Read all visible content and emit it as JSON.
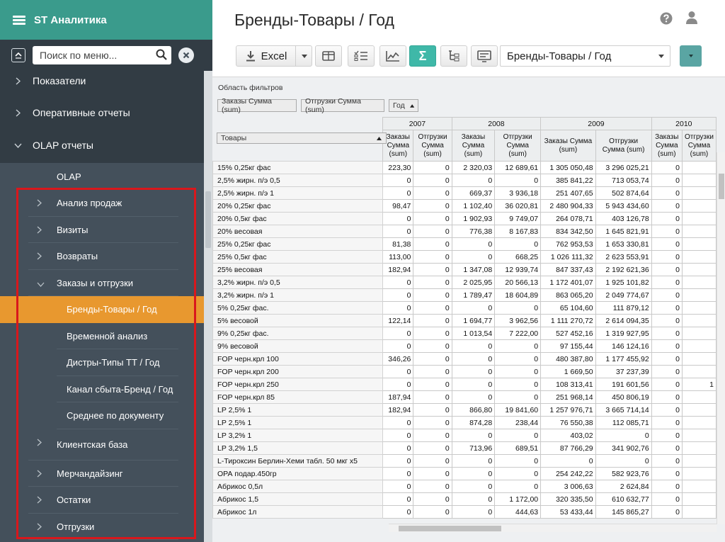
{
  "app": {
    "name": "ST Аналитика"
  },
  "search": {
    "placeholder": "Поиск по меню..."
  },
  "menu": {
    "top": [
      {
        "label": "Показатели",
        "expanded": false
      },
      {
        "label": "Оперативные отчеты",
        "expanded": false
      },
      {
        "label": "OLAP отчеты",
        "expanded": true
      }
    ],
    "olap_root": "OLAP",
    "groups_before": [
      {
        "label": "Анализ продаж"
      },
      {
        "label": "Визиты"
      },
      {
        "label": "Возвраты"
      },
      {
        "label": "Заказы и отгрузки",
        "expanded": true
      }
    ],
    "children": [
      {
        "label": "Бренды-Товары / Год",
        "active": true
      },
      {
        "label": "Временной анализ"
      },
      {
        "label": "Дистры-Типы ТТ / Год"
      },
      {
        "label": "Канал сбыта-Бренд / Год"
      },
      {
        "label": "Среднее по документу"
      }
    ],
    "groups_after": [
      {
        "label": "Клиентская база"
      },
      {
        "label": "Мерчандайзинг"
      },
      {
        "label": "Остатки"
      },
      {
        "label": "Отгрузки"
      }
    ]
  },
  "page": {
    "title": "Бренды-Товары / Год"
  },
  "toolbar": {
    "excel_label": "Excel",
    "sigma_label": "Σ",
    "report_select_value": "Бренды-Товары / Год",
    "accent": "#3fb8a8"
  },
  "pivot": {
    "filter_area_label": "Область фильтров",
    "chips": [
      "Заказы Сумма (sum)",
      "Отгрузки Сумма (sum)",
      "Год"
    ],
    "rows_field": "Товары",
    "years": [
      "2007",
      "2008",
      "2009",
      "2010"
    ],
    "measures": [
      "Заказы Сумма (sum)",
      "Отгрузки Сумма (sum)",
      "Заказы Сумма (sum)",
      "Отгрузки Сумма (sum)",
      "Заказы Сумма (sum)",
      "Отгрузки Сумма (sum)",
      "Заказы Сумма (sum)",
      "Отгрузки Сумма (sum)"
    ],
    "rows": [
      {
        "name": "15% 0,25кг фас",
        "v": [
          "223,30",
          "0",
          "2 320,03",
          "12 689,61",
          "1 305 050,48",
          "3 296 025,21",
          "0",
          ""
        ]
      },
      {
        "name": "2,5% жирн. п/э 0,5",
        "v": [
          "0",
          "0",
          "0",
          "0",
          "385 841,22",
          "713 053,74",
          "0",
          ""
        ]
      },
      {
        "name": "2,5% жирн. п/э 1",
        "v": [
          "0",
          "0",
          "669,37",
          "3 936,18",
          "251 407,65",
          "502 874,64",
          "0",
          ""
        ]
      },
      {
        "name": "20% 0,25кг фас",
        "v": [
          "98,47",
          "0",
          "1 102,40",
          "36 020,81",
          "2 480 904,33",
          "5 943 434,60",
          "0",
          ""
        ]
      },
      {
        "name": "20% 0,5кг фас",
        "v": [
          "0",
          "0",
          "1 902,93",
          "9 749,07",
          "264 078,71",
          "403 126,78",
          "0",
          ""
        ]
      },
      {
        "name": "20% весовая",
        "v": [
          "0",
          "0",
          "776,38",
          "8 167,83",
          "834 342,50",
          "1 645 821,91",
          "0",
          ""
        ]
      },
      {
        "name": "25% 0,25кг фас",
        "v": [
          "81,38",
          "0",
          "0",
          "0",
          "762 953,53",
          "1 653 330,81",
          "0",
          ""
        ]
      },
      {
        "name": "25% 0,5кг фас",
        "v": [
          "113,00",
          "0",
          "0",
          "668,25",
          "1 026 111,32",
          "2 623 553,91",
          "0",
          ""
        ]
      },
      {
        "name": "25% весовая",
        "v": [
          "182,94",
          "0",
          "1 347,08",
          "12 939,74",
          "847 337,43",
          "2 192 621,36",
          "0",
          ""
        ]
      },
      {
        "name": "3,2% жирн. п/э 0,5",
        "v": [
          "0",
          "0",
          "2 025,95",
          "20 566,13",
          "1 172 401,07",
          "1 925 101,82",
          "0",
          ""
        ]
      },
      {
        "name": "3,2% жирн. п/э 1",
        "v": [
          "0",
          "0",
          "1 789,47",
          "18 604,89",
          "863 065,20",
          "2 049 774,67",
          "0",
          ""
        ]
      },
      {
        "name": "5% 0,25кг фас.",
        "v": [
          "0",
          "0",
          "0",
          "0",
          "65 104,60",
          "111 879,12",
          "0",
          ""
        ]
      },
      {
        "name": "5% весовой",
        "v": [
          "122,14",
          "0",
          "1 694,77",
          "3 962,56",
          "1 111 270,72",
          "2 614 094,35",
          "0",
          ""
        ]
      },
      {
        "name": "9% 0,25кг фас.",
        "v": [
          "0",
          "0",
          "1 013,54",
          "7 222,00",
          "527 452,16",
          "1 319 927,95",
          "0",
          ""
        ]
      },
      {
        "name": "9% весовой",
        "v": [
          "0",
          "0",
          "0",
          "0",
          "97 155,44",
          "146 124,16",
          "0",
          ""
        ]
      },
      {
        "name": "FOP черн.крл 100",
        "v": [
          "346,26",
          "0",
          "0",
          "0",
          "480 387,80",
          "1 177 455,92",
          "0",
          ""
        ]
      },
      {
        "name": "FOP черн.крл 200",
        "v": [
          "0",
          "0",
          "0",
          "0",
          "1 669,50",
          "37 237,39",
          "0",
          ""
        ]
      },
      {
        "name": "FOP черн.крл 250",
        "v": [
          "0",
          "0",
          "0",
          "0",
          "108 313,41",
          "191 601,56",
          "0",
          "1"
        ]
      },
      {
        "name": "FOP черн.крл 85",
        "v": [
          "187,94",
          "0",
          "0",
          "0",
          "251 968,14",
          "450 806,19",
          "0",
          ""
        ]
      },
      {
        "name": "LP 2,5% 1",
        "v": [
          "182,94",
          "0",
          "866,80",
          "19 841,60",
          "1 257 976,71",
          "3 665 714,14",
          "0",
          ""
        ]
      },
      {
        "name": "LP 2,5% 1",
        "v": [
          "0",
          "0",
          "874,28",
          "238,44",
          "76 550,38",
          "112 085,71",
          "0",
          ""
        ]
      },
      {
        "name": "LP 3,2% 1",
        "v": [
          "0",
          "0",
          "0",
          "0",
          "403,02",
          "0",
          "0",
          ""
        ]
      },
      {
        "name": "LP 3,2% 1,5",
        "v": [
          "0",
          "0",
          "713,96",
          "689,51",
          "87 766,29",
          "341 902,76",
          "0",
          ""
        ]
      },
      {
        "name": "L-Тироксин Берлин-Хеми табл. 50 мкг x5",
        "v": [
          "0",
          "0",
          "0",
          "0",
          "0",
          "0",
          "0",
          ""
        ]
      },
      {
        "name": "ОРА подар.450гр",
        "v": [
          "0",
          "0",
          "0",
          "0",
          "254 242,22",
          "582 923,76",
          "0",
          ""
        ]
      },
      {
        "name": "Абрикос 0,5л",
        "v": [
          "0",
          "0",
          "0",
          "0",
          "3 006,63",
          "2 624,84",
          "0",
          ""
        ]
      },
      {
        "name": "Абрикос 1,5",
        "v": [
          "0",
          "0",
          "0",
          "1 172,00",
          "320 335,50",
          "610 632,77",
          "0",
          ""
        ]
      },
      {
        "name": "Абрикос 1л",
        "v": [
          "0",
          "0",
          "0",
          "444,63",
          "53 433,44",
          "145 865,27",
          "0",
          ""
        ]
      }
    ]
  },
  "colors": {
    "sidebar_bg": "#323c44",
    "submenu_bg": "#44505b",
    "brand_bg": "#3a9b8c",
    "active_item": "#e8982f",
    "highlight_frame": "#d9171c"
  }
}
